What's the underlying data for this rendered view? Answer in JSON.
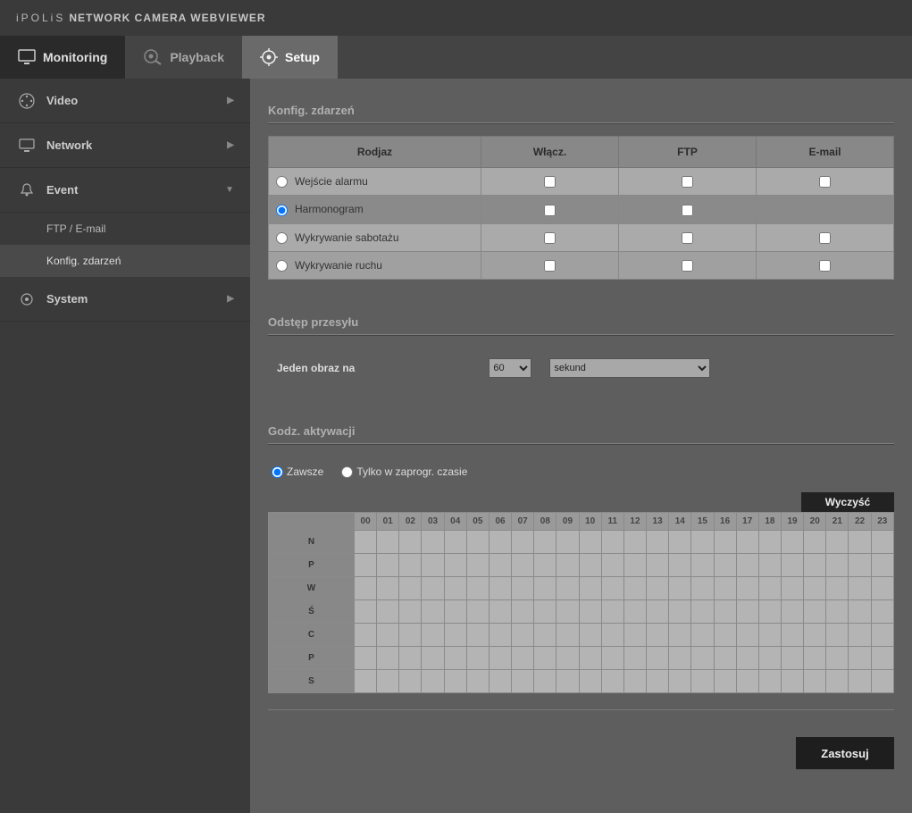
{
  "header": {
    "brand": "iPOLiS",
    "title": "NETWORK CAMERA WEBVIEWER"
  },
  "nav": {
    "monitoring": "Monitoring",
    "playback": "Playback",
    "setup": "Setup"
  },
  "sidebar": {
    "items": [
      {
        "label": "Video"
      },
      {
        "label": "Network"
      },
      {
        "label": "Event"
      },
      {
        "label": "System"
      }
    ],
    "event_children": [
      {
        "label": "FTP / E-mail"
      },
      {
        "label": "Konfig. zdarzeń"
      }
    ]
  },
  "sections": {
    "konfig": "Konfig. zdarzeń",
    "interval": "Odstęp przesyłu",
    "activation": "Godz. aktywacji"
  },
  "evt_table": {
    "headers": {
      "type": "Rodjaz",
      "enable": "Włącz.",
      "ftp": "FTP",
      "email": "E-mail"
    },
    "rows": [
      {
        "name": "Wejście alarmu",
        "selected": false,
        "email": true
      },
      {
        "name": "Harmonogram",
        "selected": true,
        "email": false
      },
      {
        "name": "Wykrywanie sabotażu",
        "selected": false,
        "email": true
      },
      {
        "name": "Wykrywanie ruchu",
        "selected": false,
        "email": true
      }
    ]
  },
  "interval": {
    "label": "Jeden obraz na",
    "value": "60",
    "unit": "sekund"
  },
  "activation": {
    "always": "Zawsze",
    "scheduled": "Tylko w zaprogr. czasie",
    "selected": "always",
    "clear": "Wyczyść"
  },
  "schedule": {
    "hours": [
      "00",
      "01",
      "02",
      "03",
      "04",
      "05",
      "06",
      "07",
      "08",
      "09",
      "10",
      "11",
      "12",
      "13",
      "14",
      "15",
      "16",
      "17",
      "18",
      "19",
      "20",
      "21",
      "22",
      "23"
    ],
    "days": [
      "N",
      "P",
      "W",
      "Ś",
      "C",
      "P",
      "S"
    ]
  },
  "apply": "Zastosuj"
}
